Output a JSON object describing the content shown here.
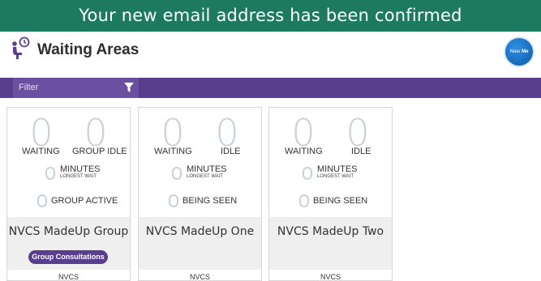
{
  "banner": {
    "message": "Your new email address has been confirmed"
  },
  "header": {
    "title": "Waiting Areas",
    "near_me": {
      "word1": "Near",
      "word2": "Me"
    }
  },
  "filter": {
    "placeholder": "Filter"
  },
  "colors": {
    "banner": "#1d7a5f",
    "filter_bar": "#5a3e8e",
    "badge": "#5a3e8e",
    "counter": "#c8d2dc"
  },
  "cards": [
    {
      "waiting_count": "0",
      "second_count": "0",
      "waiting_label": "WAITING",
      "second_label": "GROUP IDLE",
      "minutes_count": "0",
      "minutes_label": "MINUTES",
      "longest_label": "LONGEST WAIT",
      "third_count": "0",
      "third_label": "GROUP ACTIVE",
      "name": "NVCS MadeUp Group",
      "badge": "Group Consultations",
      "org": "NVCS"
    },
    {
      "waiting_count": "0",
      "second_count": "0",
      "waiting_label": "WAITING",
      "second_label": "IDLE",
      "minutes_count": "0",
      "minutes_label": "MINUTES",
      "longest_label": "LONGEST WAIT",
      "third_count": "0",
      "third_label": "BEING SEEN",
      "name": "NVCS MadeUp One",
      "org": "NVCS"
    },
    {
      "waiting_count": "0",
      "second_count": "0",
      "waiting_label": "WAITING",
      "second_label": "IDLE",
      "minutes_count": "0",
      "minutes_label": "MINUTES",
      "longest_label": "LONGEST WAIT",
      "third_count": "0",
      "third_label": "BEING SEEN",
      "name": "NVCS MadeUp Two",
      "org": "NVCS"
    }
  ]
}
